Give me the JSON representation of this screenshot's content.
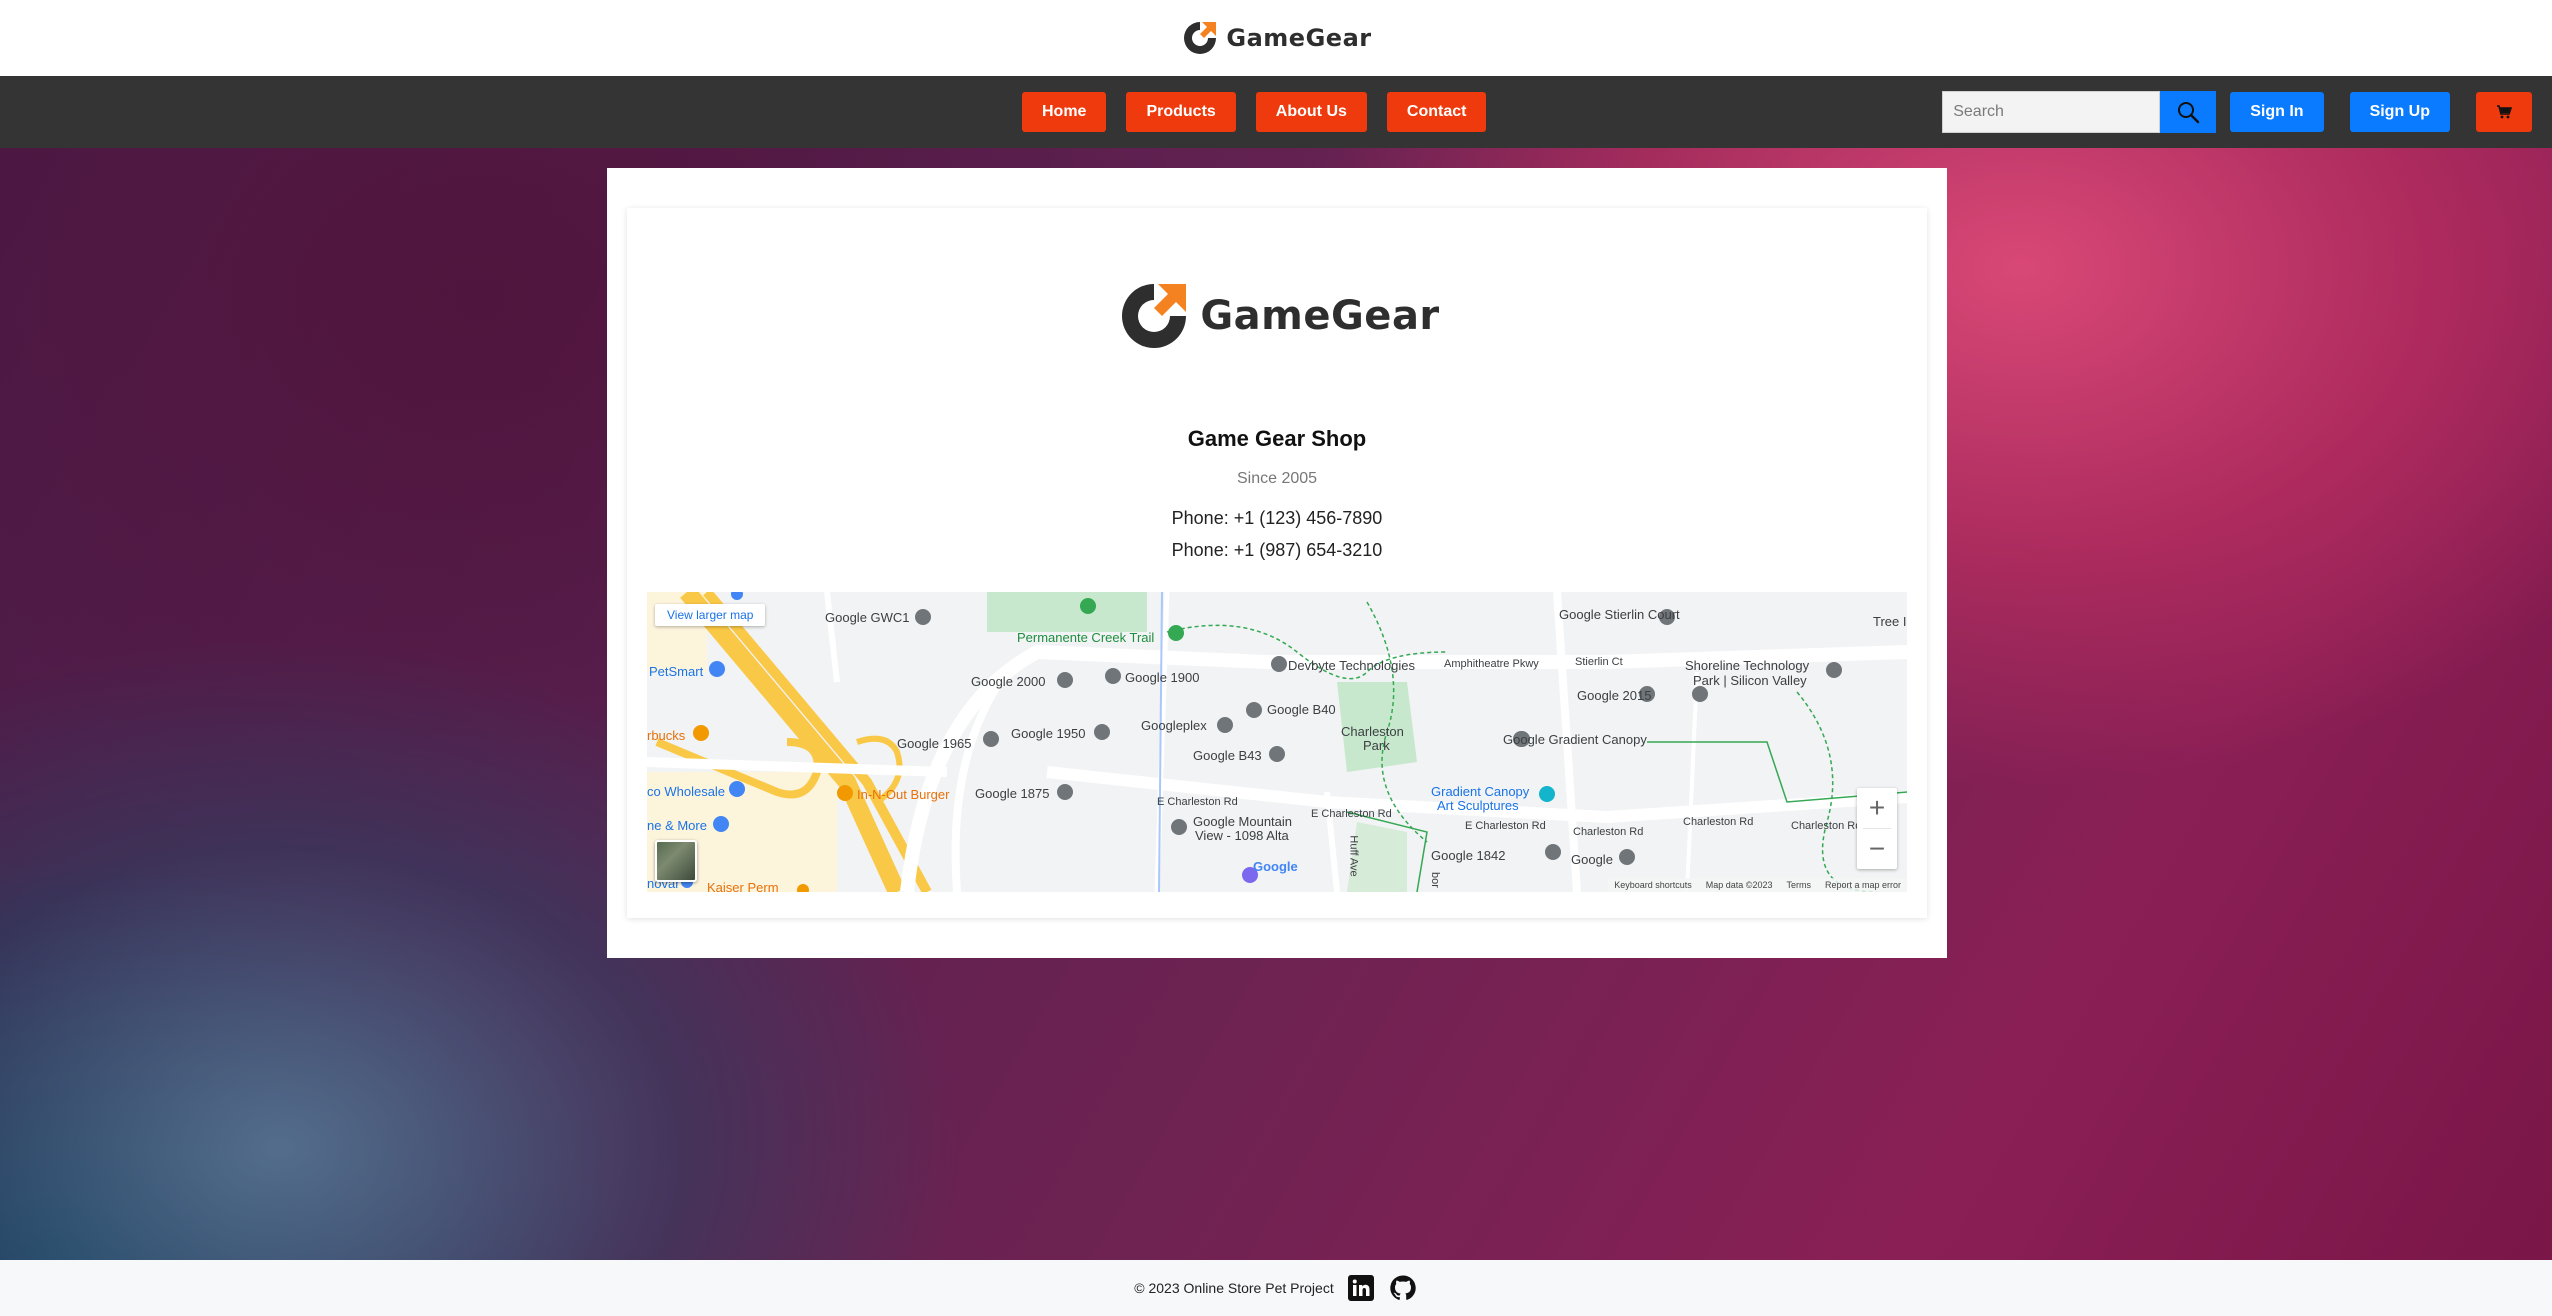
{
  "brand": {
    "name": "GameGear",
    "primary_color": "#2e2e2e",
    "accent_color": "#f58220",
    "logo_icon": "gamegear-logo-icon"
  },
  "nav": {
    "links": [
      {
        "label": "Home"
      },
      {
        "label": "Products"
      },
      {
        "label": "About Us"
      },
      {
        "label": "Contact"
      }
    ],
    "link_color": "#ee3a0c",
    "search_placeholder": "Search",
    "search_icon": "search-icon",
    "sign_in": "Sign In",
    "sign_up": "Sign Up",
    "auth_color": "#0a7bff",
    "cart_icon": "cart-icon"
  },
  "contact": {
    "shop_name": "Game Gear Shop",
    "since": "Since 2005",
    "phone1": "Phone: +1 (123) 456-7890",
    "phone2": "Phone: +1 (987) 654-3210"
  },
  "map": {
    "view_larger": "View larger map",
    "labels": {
      "google_gwc1": "Google GWC1",
      "permanente": "Permanente Creek Trail",
      "devbyte": "Devbyte Technologies",
      "amphitheatre": "Amphitheatre Pkwy",
      "stierlin_court": "Google Stierlin Court",
      "stierlin_ct": "Stierlin Ct",
      "shoreline": "Shoreline Technology",
      "shoreline2": "Park | Silicon Valley",
      "tree": "Tree I",
      "petsmart": "PetSmart",
      "google2000": "Google 2000",
      "google1900": "Google 1900",
      "google2015": "Google 2015",
      "googleplex": "Googleplex",
      "google_b40": "Google B40",
      "charleston_park": "Charleston",
      "charleston_park2": "Park",
      "gradient_canopy": "Google Gradient Canopy",
      "rbucks": "rbucks",
      "google1965": "Google 1965",
      "google1950": "Google 1950",
      "google_b43": "Google B43",
      "co_wholesale": "co Wholesale",
      "in_n_out": "In-N-Out Burger",
      "google1875": "Google 1875",
      "e_charleston": "E Charleston Rd",
      "e_charleston2": "E Charleston Rd",
      "e_charleston3": "E Charleston Rd",
      "gradient_art": "Gradient Canopy",
      "gradient_art2": "Art Sculptures",
      "charleston_rd": "Charleston Rd",
      "charleston_rd2": "Charleston Rd",
      "charleston_rd3": "Charleston Rd",
      "ne_more": "ne & More",
      "mountain_view": "Google Mountain",
      "mountain_view2": "View - 1098 Alta",
      "google1842": "Google 1842",
      "google": "Google",
      "huff": "Huff Ave",
      "garcia": "bor",
      "novar": "novar",
      "kaiser": "Kaiser Perm"
    },
    "google_mark": "Google",
    "zoom_in": "+",
    "zoom_out": "−",
    "attribution": [
      "Keyboard shortcuts",
      "Map data ©2023",
      "Terms",
      "Report a map error"
    ]
  },
  "footer": {
    "text": "© 2023 Online Store Pet Project",
    "linkedin_icon": "linkedin-icon",
    "github_icon": "github-icon"
  }
}
